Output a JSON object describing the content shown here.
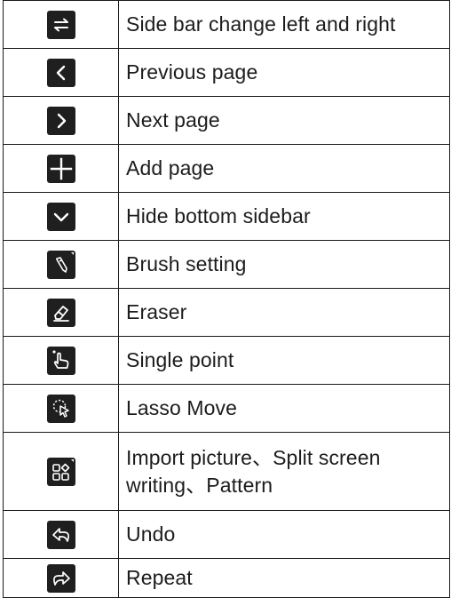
{
  "rows": [
    {
      "icon": "swap-arrows-icon",
      "label": "Side bar change left and right"
    },
    {
      "icon": "chevron-left-icon",
      "label": "Previous page"
    },
    {
      "icon": "chevron-right-icon",
      "label": "Next page"
    },
    {
      "icon": "plus-icon",
      "label": "Add page"
    },
    {
      "icon": "chevron-down-icon",
      "label": "Hide bottom sidebar"
    },
    {
      "icon": "pen-icon",
      "label": "Brush setting"
    },
    {
      "icon": "eraser-icon",
      "label": "Eraser"
    },
    {
      "icon": "hand-pointer-icon",
      "label": "Single point"
    },
    {
      "icon": "lasso-cursor-icon",
      "label": "Lasso Move"
    },
    {
      "icon": "grid-apps-icon",
      "label": "Import picture、Split screen writing、Pattern"
    },
    {
      "icon": "undo-icon",
      "label": "Undo"
    },
    {
      "icon": "redo-icon",
      "label": "Repeat"
    }
  ]
}
